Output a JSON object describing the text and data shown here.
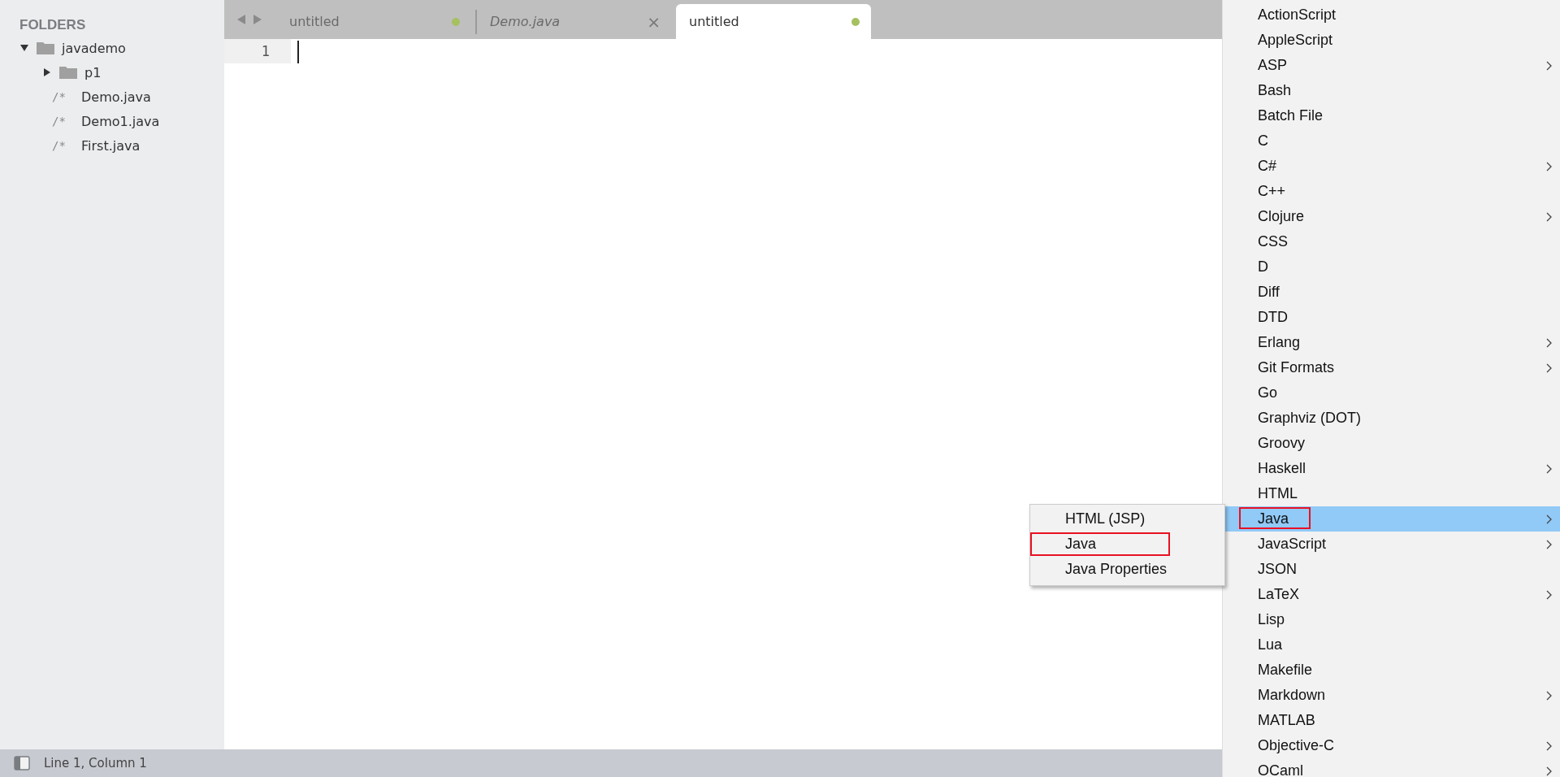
{
  "sidebar": {
    "heading": "FOLDERS",
    "tree": [
      {
        "name": "javademo",
        "kind": "folder",
        "expanded": true,
        "children": [
          {
            "name": "p1",
            "kind": "folder",
            "expanded": false
          },
          {
            "name": "Demo.java",
            "kind": "file",
            "icon": "/*"
          },
          {
            "name": "Demo1.java",
            "kind": "file",
            "icon": "/*"
          },
          {
            "name": "First.java",
            "kind": "file",
            "icon": "/*"
          }
        ]
      }
    ]
  },
  "tabs": [
    {
      "label": "untitled",
      "selected": false,
      "preview": false,
      "dirty": true
    },
    {
      "label": "Demo.java",
      "selected": false,
      "preview": true,
      "dirty": false,
      "close": "×"
    },
    {
      "label": "untitled",
      "selected": true,
      "preview": false,
      "dirty": true
    }
  ],
  "editor": {
    "line_numbers": [
      "1"
    ]
  },
  "status_bar": {
    "text": "Line 1, Column 1"
  },
  "syntax_menu": {
    "items": [
      {
        "label": "ActionScript",
        "has_submenu": false,
        "selected": false,
        "outlined": false
      },
      {
        "label": "AppleScript",
        "has_submenu": false,
        "selected": false,
        "outlined": false
      },
      {
        "label": "ASP",
        "has_submenu": true,
        "selected": false,
        "outlined": false
      },
      {
        "label": "Bash",
        "has_submenu": false,
        "selected": false,
        "outlined": false
      },
      {
        "label": "Batch File",
        "has_submenu": false,
        "selected": false,
        "outlined": false
      },
      {
        "label": "C",
        "has_submenu": false,
        "selected": false,
        "outlined": false
      },
      {
        "label": "C#",
        "has_submenu": true,
        "selected": false,
        "outlined": false
      },
      {
        "label": "C++",
        "has_submenu": false,
        "selected": false,
        "outlined": false
      },
      {
        "label": "Clojure",
        "has_submenu": true,
        "selected": false,
        "outlined": false
      },
      {
        "label": "CSS",
        "has_submenu": false,
        "selected": false,
        "outlined": false
      },
      {
        "label": "D",
        "has_submenu": false,
        "selected": false,
        "outlined": false
      },
      {
        "label": "Diff",
        "has_submenu": false,
        "selected": false,
        "outlined": false
      },
      {
        "label": "DTD",
        "has_submenu": false,
        "selected": false,
        "outlined": false
      },
      {
        "label": "Erlang",
        "has_submenu": true,
        "selected": false,
        "outlined": false
      },
      {
        "label": "Git Formats",
        "has_submenu": true,
        "selected": false,
        "outlined": false
      },
      {
        "label": "Go",
        "has_submenu": false,
        "selected": false,
        "outlined": false
      },
      {
        "label": "Graphviz (DOT)",
        "has_submenu": false,
        "selected": false,
        "outlined": false
      },
      {
        "label": "Groovy",
        "has_submenu": false,
        "selected": false,
        "outlined": false
      },
      {
        "label": "Haskell",
        "has_submenu": true,
        "selected": false,
        "outlined": false
      },
      {
        "label": "HTML",
        "has_submenu": false,
        "selected": false,
        "outlined": false
      },
      {
        "label": "Java",
        "has_submenu": true,
        "selected": true,
        "outlined": true
      },
      {
        "label": "JavaScript",
        "has_submenu": true,
        "selected": false,
        "outlined": false
      },
      {
        "label": "JSON",
        "has_submenu": false,
        "selected": false,
        "outlined": false
      },
      {
        "label": "LaTeX",
        "has_submenu": true,
        "selected": false,
        "outlined": false
      },
      {
        "label": "Lisp",
        "has_submenu": false,
        "selected": false,
        "outlined": false
      },
      {
        "label": "Lua",
        "has_submenu": false,
        "selected": false,
        "outlined": false
      },
      {
        "label": "Makefile",
        "has_submenu": false,
        "selected": false,
        "outlined": false
      },
      {
        "label": "Markdown",
        "has_submenu": true,
        "selected": false,
        "outlined": false
      },
      {
        "label": "MATLAB",
        "has_submenu": false,
        "selected": false,
        "outlined": false
      },
      {
        "label": "Objective-C",
        "has_submenu": true,
        "selected": false,
        "outlined": false
      },
      {
        "label": "OCaml",
        "has_submenu": true,
        "selected": false,
        "outlined": false
      }
    ]
  },
  "java_submenu": {
    "items": [
      {
        "label": "HTML (JSP)",
        "has_submenu": false,
        "selected": false,
        "outlined": false
      },
      {
        "label": "Java",
        "has_submenu": false,
        "selected": false,
        "outlined": true
      },
      {
        "label": "Java Properties",
        "has_submenu": false,
        "selected": false,
        "outlined": false
      }
    ]
  }
}
